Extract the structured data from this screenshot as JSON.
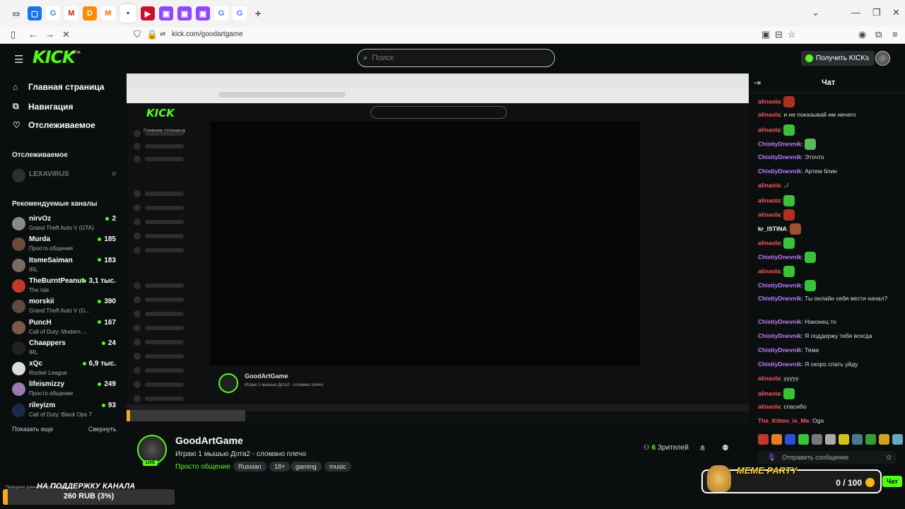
{
  "browser": {
    "url": "kick.com/goodartgame"
  },
  "header": {
    "search_placeholder": "Поиск",
    "kicks_label": "Получить KICKs",
    "logo": "KICK",
    "beta": "BETA"
  },
  "sidebar": {
    "nav": [
      {
        "label": "Главная страница",
        "icon": "home-icon"
      },
      {
        "label": "Навигация",
        "icon": "compass-icon"
      },
      {
        "label": "Отслеживаемое",
        "icon": "heart-icon"
      }
    ],
    "followed_header": "Отслеживаемое",
    "followed_channel": "LEXAVIRUS",
    "recommended_header": "Рекомендуемые каналы",
    "channels": [
      {
        "name": "nirvOz",
        "game": "Grand Theft Auto V (GTA)",
        "viewers": "2",
        "color": "#8a8a8a"
      },
      {
        "name": "Murda",
        "game": "Просто общение",
        "viewers": "185",
        "color": "#6b4a3a"
      },
      {
        "name": "ItsmeSaiman",
        "game": "IRL",
        "viewers": "183",
        "color": "#7a6a60"
      },
      {
        "name": "TheBurntPeanut",
        "game": "The Isle",
        "viewers": "3,1 тыс.",
        "color": "#c0392b"
      },
      {
        "name": "morskii",
        "game": "Grand Theft Auto V (G...",
        "viewers": "390",
        "color": "#5a4a40"
      },
      {
        "name": "PuncH",
        "game": "Call of Duty: Modern ...",
        "viewers": "167",
        "color": "#7b5a4a"
      },
      {
        "name": "Chaappers",
        "game": "IRL",
        "viewers": "24",
        "color": "#222"
      },
      {
        "name": "xQc",
        "game": "Rocket League",
        "viewers": "6,9 тыс.",
        "color": "#ddd"
      },
      {
        "name": "lifeismizzy",
        "game": "Просто общение",
        "viewers": "249",
        "color": "#9a7ab0"
      },
      {
        "name": "rileyizm",
        "game": "Call of Duty: Black Ops 7",
        "viewers": "93",
        "color": "#1a2a4a"
      }
    ],
    "show_more": "Показать еще",
    "collapse": "Свернуть"
  },
  "stream": {
    "mini_header": "Главная страница",
    "channel_name": "GoodArtGame",
    "title": "Играю 1 мышью Дота2 - сломано плечо",
    "category": "Просто общение",
    "tags": [
      "Russian",
      "18+",
      "gaming",
      "music"
    ],
    "viewers_count": "6",
    "viewers_label": "Зрителей",
    "live": "LIVE"
  },
  "chat": {
    "title": "Чат",
    "messages": [
      {
        "user": "alinaola",
        "color": "#ff5a5a",
        "text": "",
        "emote": "#b03020"
      },
      {
        "user": "alinaola",
        "color": "#ff5a5a",
        "text": "и не показывай им ничего"
      },
      {
        "user": "alinaola",
        "color": "#ff5a5a",
        "text": "",
        "emote": "#3ac13a"
      },
      {
        "user": "ChistiyDnevnik",
        "color": "#c080ff",
        "text": "",
        "emote": "#5ab85a"
      },
      {
        "user": "ChistiyDnevnik",
        "color": "#c080ff",
        "text": "Эточто"
      },
      {
        "user": "ChistiyDnevnik",
        "color": "#c080ff",
        "text": "Артем блин"
      },
      {
        "user": "alinaola",
        "color": "#ff5a5a",
        "text": " ⸝/"
      },
      {
        "user": "alinaola",
        "color": "#ff5a5a",
        "text": "",
        "emote": "#3ac13a"
      },
      {
        "user": "alinaola",
        "color": "#ff5a5a",
        "text": "",
        "emote": "#b03020"
      },
      {
        "user": "kr_ISTINA",
        "color": "#ffffff",
        "text": "",
        "emote": "#a05030"
      },
      {
        "user": "alinaola",
        "color": "#ff5a5a",
        "text": "",
        "emote": "#3ac13a"
      },
      {
        "user": "ChistiyDnevnik",
        "color": "#c080ff",
        "text": "",
        "emote": "#3ac13a"
      },
      {
        "user": "alinaola",
        "color": "#ff5a5a",
        "text": "",
        "emote": "#3ac13a"
      },
      {
        "user": "ChistiyDnevnik",
        "color": "#c080ff",
        "text": "",
        "emote": "#3ac13a"
      },
      {
        "user": "ChistiyDnevnik",
        "color": "#c080ff",
        "text": "Ты онлайн себя вести начал?"
      },
      {
        "user": "ChistiyDnevnik",
        "color": "#c080ff",
        "text": "Наконец то"
      },
      {
        "user": "ChistiyDnevnik",
        "color": "#c080ff",
        "text": "Я поддержу тебя всегда"
      },
      {
        "user": "ChistiyDnevnik",
        "color": "#c080ff",
        "text": "Тема"
      },
      {
        "user": "ChistiyDnevnik",
        "color": "#c080ff",
        "text": "Я скоро спать уйду"
      },
      {
        "user": "alinaola",
        "color": "#ff5a5a",
        "text": "ууууу"
      },
      {
        "user": "alinaola",
        "color": "#ff5a5a",
        "text": "",
        "emote": "#3ac13a"
      },
      {
        "user": "alinaola",
        "color": "#ff5a5a",
        "text": "спасибо"
      },
      {
        "user": "The_Kitten_is_Me",
        "color": "#ff5a5a",
        "text": "Ogo"
      }
    ],
    "input_placeholder": "Отправить сообщение",
    "send_label": "Чат"
  },
  "overlay": {
    "meme_label": "MEME PARTY",
    "meme_count": "0 / 100",
    "support_label": "НА ПОДДЕРЖКУ КАНАЛА",
    "donate_text": "260 RUB (3%)",
    "donate_fraction": 0.03,
    "tiny_text": "Передача данных с upload.kick..."
  }
}
